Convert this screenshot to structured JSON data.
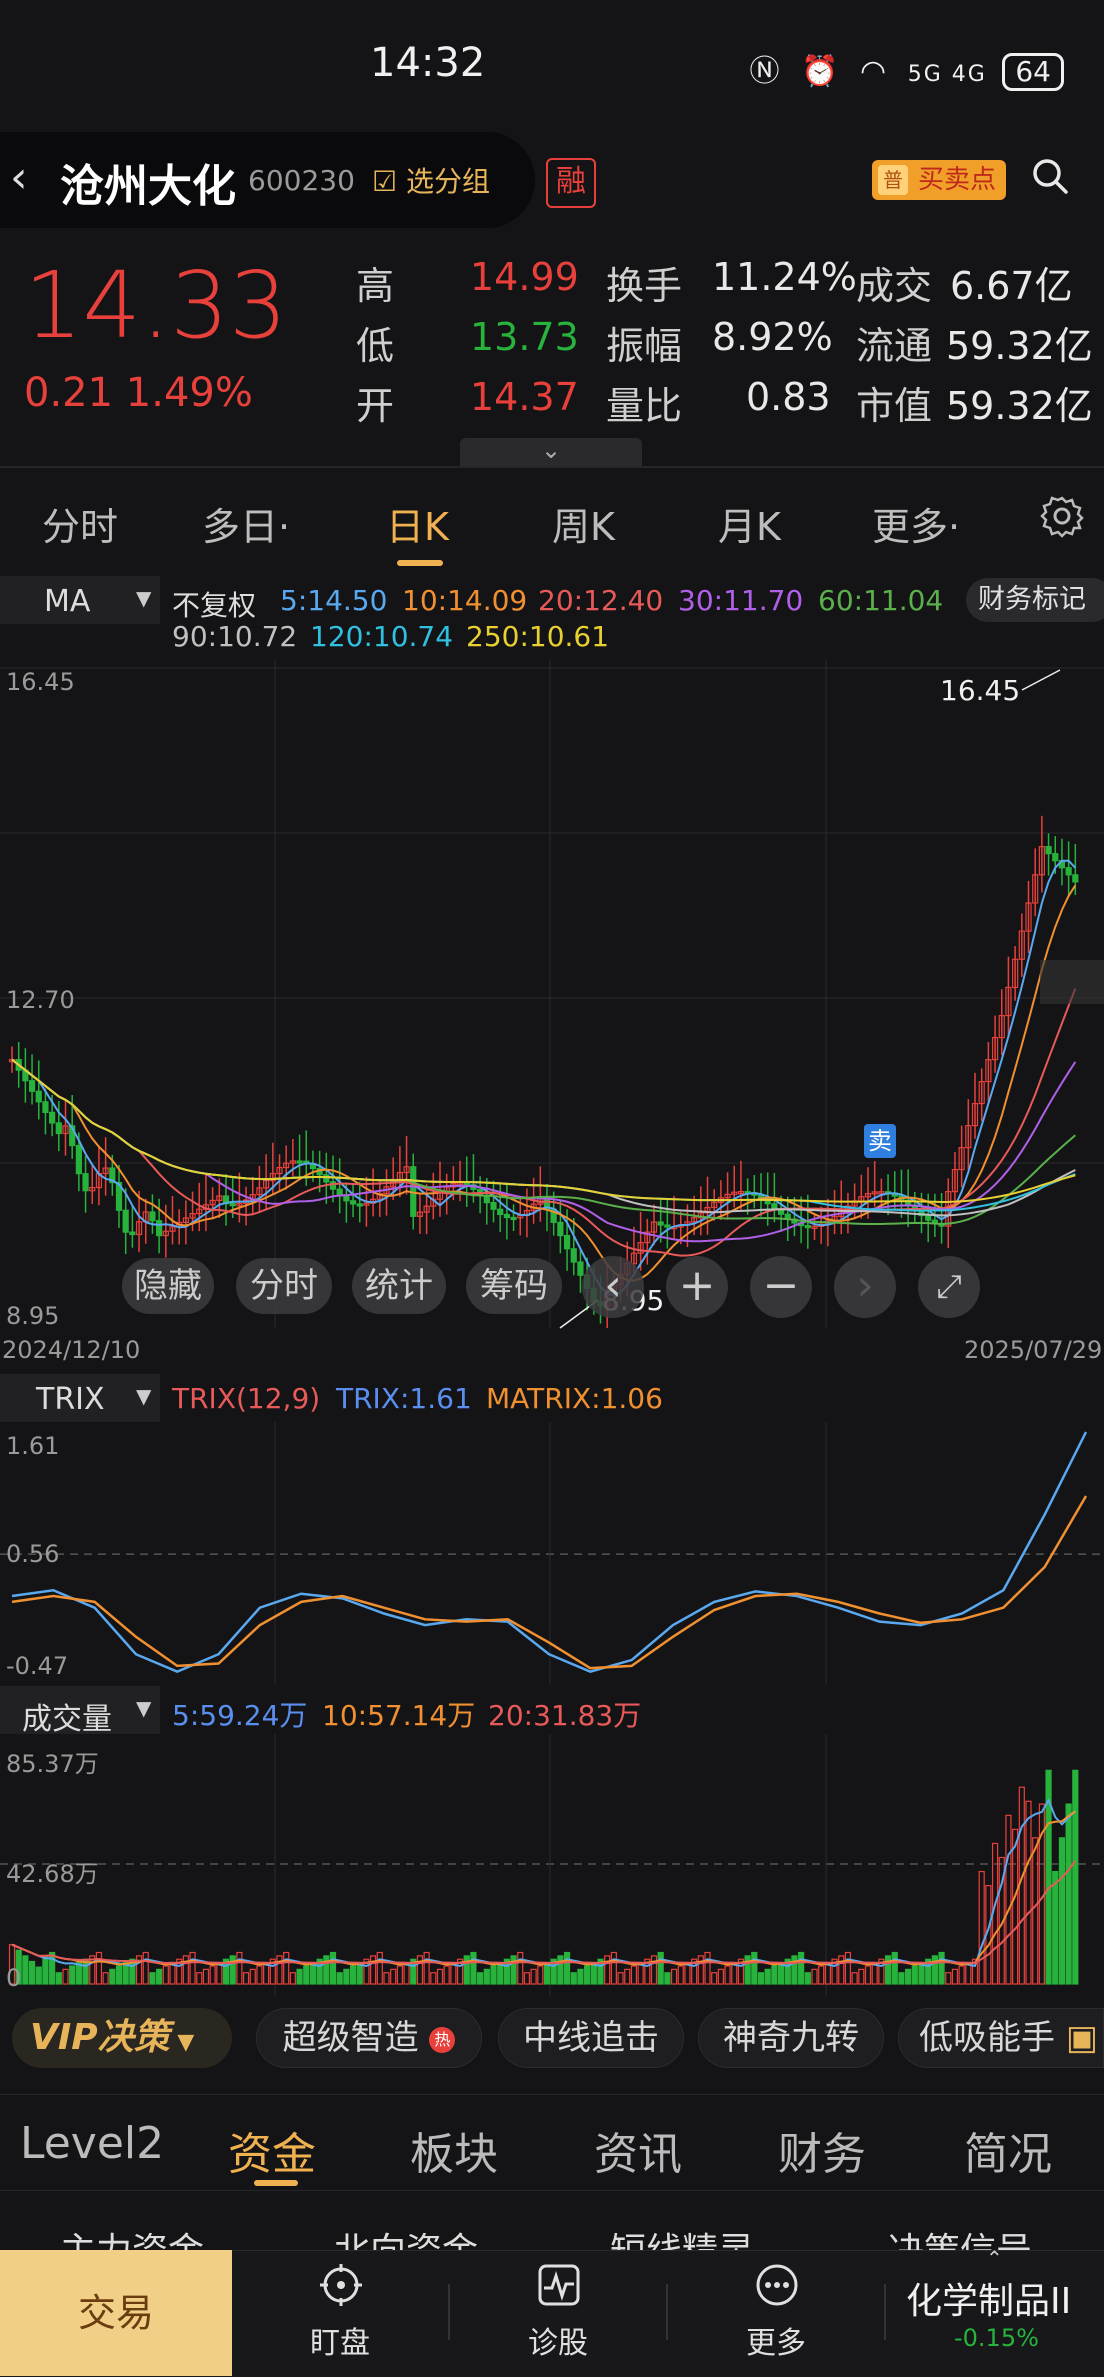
{
  "status_bar": {
    "time": "14:32",
    "signal": "5G 4G",
    "battery": "64"
  },
  "header": {
    "stock_name": "沧州大化",
    "stock_code": "600230",
    "select_group": "选分组",
    "margin_badge": "融",
    "buy_sell_prefix": "普",
    "buy_sell": "买卖点"
  },
  "quote": {
    "price": "14.33",
    "change": "0.21 1.49%",
    "high_label": "高",
    "high": "14.99",
    "low_label": "低",
    "low": "13.73",
    "open_label": "开",
    "open": "14.37",
    "turnover_label": "换手",
    "turnover": "11.24%",
    "amplitude_label": "振幅",
    "amplitude": "8.92%",
    "vol_ratio_label": "量比",
    "vol_ratio": "0.83",
    "amount_label": "成交",
    "amount": "6.67亿",
    "float_label": "流通",
    "float_cap": "59.32亿",
    "mcap_label": "市值",
    "market_cap": "59.32亿"
  },
  "period_tabs": [
    "分时",
    "多日·",
    "日K",
    "周K",
    "月K",
    "更多·"
  ],
  "active_period": "日K",
  "ma_legend": {
    "selector": "MA",
    "adjust": "不复权",
    "ma5": "5:14.50",
    "ma10": "10:14.09",
    "ma20": "20:12.40",
    "ma30": "30:11.70",
    "ma60": "60:11.04",
    "ma90": "90:10.72",
    "ma120": "120:10.74",
    "ma250": "250:10.61",
    "finance_mark": "财务标记"
  },
  "colors": {
    "up": "#e8413c",
    "down": "#27b33c",
    "ma5": "#5aa9f0",
    "ma10": "#f09030",
    "ma20": "#e85a5a",
    "ma30": "#b060e8",
    "ma60": "#5ab04a",
    "ma90": "#c0c0c0",
    "ma120": "#30c0e0",
    "ma250": "#e8d030",
    "accent": "#f0b150"
  },
  "chart_data": [
    {
      "type": "candlestick",
      "title": "",
      "y_ticks": [
        "16.45",
        "12.70",
        "8.95"
      ],
      "ylim": [
        8.95,
        16.45
      ],
      "x_start": "2024/12/10",
      "x_end": "2025/07/29",
      "max_annotation": "16.45",
      "min_annotation": "8.95",
      "signal": "卖"
    },
    {
      "type": "line",
      "indicator": "TRIX",
      "params": "TRIX(12,9)",
      "trix_label": "TRIX:1.61",
      "matrix_label": "MATRIX:1.06",
      "y_ticks": [
        "1.61",
        "0.56",
        "-0.47"
      ],
      "ylim": [
        -0.47,
        1.61
      ],
      "series": [
        {
          "name": "TRIX",
          "values": [
            0.2,
            0.25,
            0.1,
            -0.3,
            -0.45,
            -0.3,
            0.1,
            0.22,
            0.18,
            0.05,
            -0.05,
            0.0,
            -0.02,
            -0.3,
            -0.45,
            -0.35,
            -0.05,
            0.15,
            0.24,
            0.2,
            0.1,
            -0.02,
            -0.05,
            0.05,
            0.25,
            0.9,
            1.61
          ]
        },
        {
          "name": "MATRIX",
          "values": [
            0.15,
            0.2,
            0.15,
            -0.15,
            -0.4,
            -0.38,
            -0.05,
            0.15,
            0.2,
            0.1,
            0.0,
            -0.02,
            0.0,
            -0.2,
            -0.42,
            -0.4,
            -0.15,
            0.08,
            0.2,
            0.22,
            0.15,
            0.05,
            -0.03,
            0.0,
            0.1,
            0.45,
            1.06
          ]
        }
      ]
    },
    {
      "type": "bar",
      "indicator": "成交量",
      "ma5_label": "5:59.24万",
      "ma10_label": "10:57.14万",
      "ma20_label": "20:31.83万",
      "y_ticks": [
        "85.37万",
        "42.68万",
        "0"
      ],
      "ylim": [
        0,
        85.37
      ]
    }
  ],
  "chart_tools": [
    "隐藏",
    "分时",
    "统计",
    "筹码"
  ],
  "trix_selector": "TRIX",
  "volume_selector": "成交量",
  "strategy_row": {
    "vip": "VIP决策",
    "chips": [
      "超级智造",
      "中线追击",
      "神奇九转",
      "低吸能手"
    ],
    "hot_badge": "热"
  },
  "bottom_tabs": [
    "Level2",
    "资金",
    "板块",
    "资讯",
    "财务",
    "简况"
  ],
  "active_bottom_tab": "资金",
  "sub_tabs": [
    "主力资金",
    "北向资金",
    "短线精灵",
    "决策信号"
  ],
  "footer": {
    "trade": "交易",
    "watch": "盯盘",
    "diagnose": "诊股",
    "more": "更多",
    "sector_name": "化学制品II",
    "sector_change": "-0.15%"
  }
}
